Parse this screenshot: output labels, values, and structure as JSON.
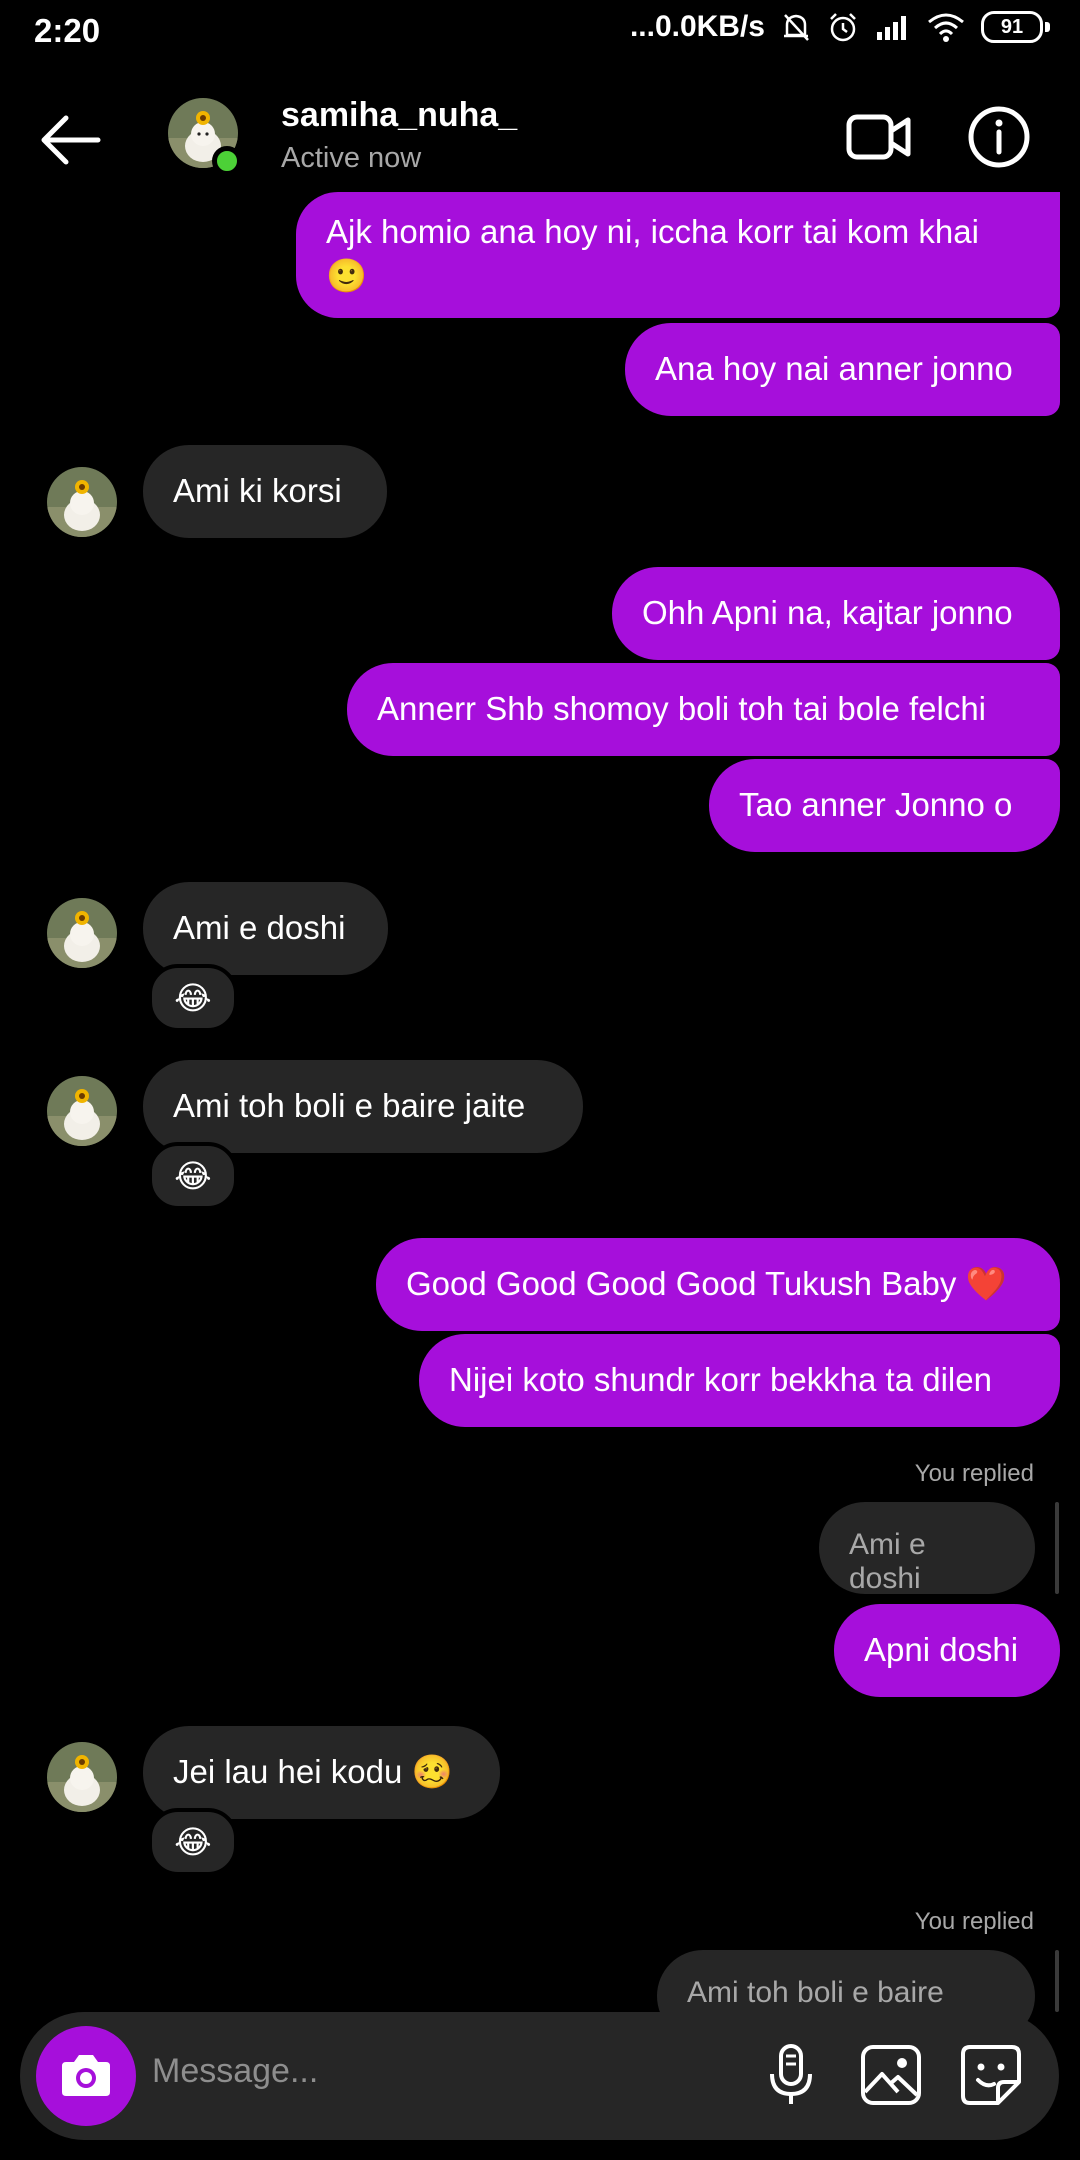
{
  "status_bar": {
    "time": "2:20",
    "network_speed": "...0.0KB/s",
    "battery": "91"
  },
  "header": {
    "username": "samiha_nuha_",
    "status": "Active now",
    "online_color": "#4cd137"
  },
  "colors": {
    "outgoing_bubble": "#a60fdb",
    "incoming_bubble": "#262626",
    "background": "#000000"
  },
  "messages": {
    "m1": "Ajk homio ana hoy ni, iccha korr tai kom khai",
    "m1_emoji": "🙂",
    "m2": "Ana hoy nai anner jonno",
    "m3": "Ami ki korsi",
    "m4": "Ohh Apni na, kajtar jonno",
    "m5": "Annerr Shb shomoy boli toh tai bole felchi",
    "m6": "Tao anner Jonno o",
    "m7": "Ami e doshi",
    "m7_reaction": "😂",
    "m8": "Ami toh boli e baire jaite",
    "m8_reaction": "😂",
    "m9": "Good Good Good Good Tukush Baby ❤️",
    "m10": "Nijei koto shundr korr bekkha ta dilen",
    "m11_label": "You replied",
    "m11_quote": "Ami e doshi",
    "m12": "Apni doshi",
    "m13": "Jei lau hei kodu 🥴",
    "m13_reaction": "😂",
    "m14_label": "You replied",
    "m14_quote": "Ami toh boli e baire jaite"
  },
  "composer": {
    "placeholder": "Message..."
  }
}
